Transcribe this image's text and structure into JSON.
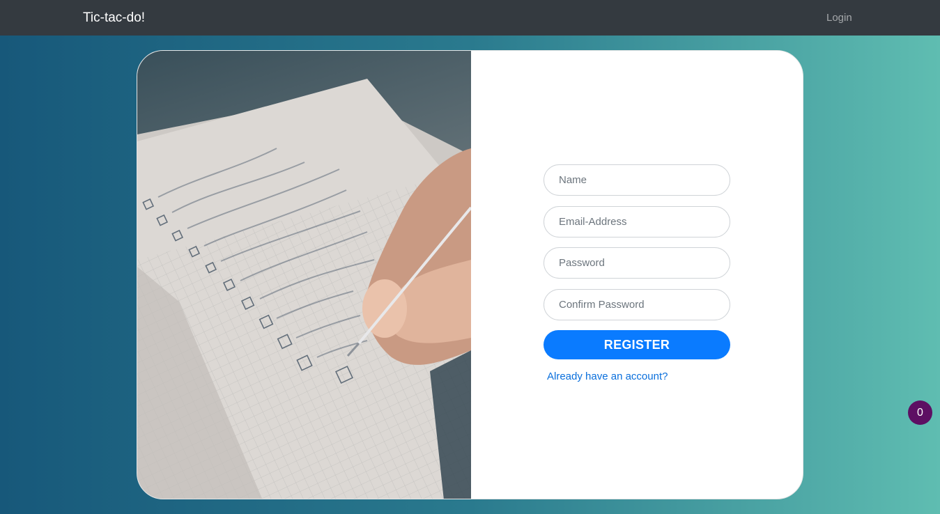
{
  "navbar": {
    "brand": "Tic-tac-do!",
    "login_label": "Login"
  },
  "register_form": {
    "name_placeholder": "Name",
    "email_placeholder": "Email-Address",
    "password_placeholder": "Password",
    "confirm_password_placeholder": "Confirm Password",
    "register_label": "REGISTER",
    "account_link": "Already have an account?"
  },
  "badge": {
    "count": "0"
  },
  "image": {
    "description_icon": "notebook-checklist-photo"
  },
  "colors": {
    "navbar": "#343a40",
    "primary_button": "#0a7bff",
    "link": "#0a6fdc",
    "badge": "#5d0f63",
    "gradient_left": "#17587a",
    "gradient_right": "#5fbdb1"
  }
}
